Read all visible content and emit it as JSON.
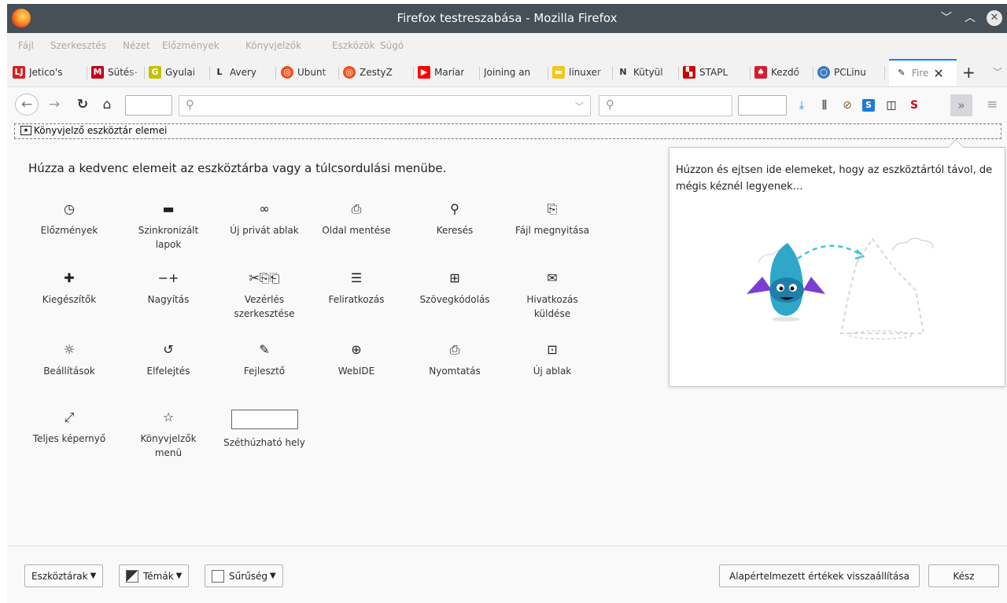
{
  "window": {
    "title": "Firefox testreszabása - Mozilla Firefox"
  },
  "menubar": [
    "Fájl",
    "Szerkesztés",
    "Nézet",
    "Előzmények",
    "Könyvjelzők",
    "Eszközök",
    "Súgó"
  ],
  "tabs": [
    {
      "label": "Jetico's",
      "favicon_color": "#d32020",
      "glyph": "LJ"
    },
    {
      "label": "Sütés-",
      "favicon_color": "#c3001a",
      "glyph": "M"
    },
    {
      "label": "Gyulai",
      "favicon_color": "#c6c000",
      "glyph": "G"
    },
    {
      "label": "Avery",
      "favicon_color": "#222222",
      "glyph": "L"
    },
    {
      "label": "Ubunt",
      "favicon_color": "#e95420",
      "glyph": "◎"
    },
    {
      "label": "ZestyZ",
      "favicon_color": "#e95420",
      "glyph": "◎"
    },
    {
      "label": "Mariar",
      "favicon_color": "#ff0000",
      "glyph": "▶"
    },
    {
      "label": "Joining an",
      "favicon_color": "",
      "glyph": ""
    },
    {
      "label": "linuxer",
      "favicon_color": "#f5c518",
      "glyph": "▬"
    },
    {
      "label": "Kütyül",
      "favicon_color": "#333333",
      "glyph": "N"
    },
    {
      "label": "STAPL",
      "favicon_color": "#cc0000",
      "glyph": "▚"
    },
    {
      "label": "Kezdő",
      "favicon_color": "#d21f2e",
      "glyph": "♠"
    },
    {
      "label": "PCLinu",
      "favicon_color": "#3b7bbf",
      "glyph": "○"
    }
  ],
  "active_tab": {
    "label": "Fire",
    "close": "✕"
  },
  "toolbar": {
    "urlbar_icon": "search-icon",
    "overflow_label": "»"
  },
  "bookmarks_toolbar": {
    "label": "Könyvjelző eszköztár elemei"
  },
  "customize": {
    "heading": "Húzza a kedvenc elemeit az eszköztárba vagy a túlcsordulási menübe.",
    "items": [
      {
        "icon": "◷",
        "label": "Előzmények"
      },
      {
        "icon": "▬",
        "label": "Szinkronizált lapok"
      },
      {
        "icon": "∞",
        "label": "Új privát ablak"
      },
      {
        "icon": "⎙",
        "label": "Oldal mentése"
      },
      {
        "icon": "⚲",
        "label": "Keresés"
      },
      {
        "icon": "⎘",
        "label": "Fájl megnyitása"
      },
      {
        "icon": "✚",
        "label": "Kiegészítők"
      },
      {
        "icon": "−+",
        "label": "Nagyítás"
      },
      {
        "icon": "✂⎘⎗",
        "label": "Vezérlés szerkesztése"
      },
      {
        "icon": "☰",
        "label": "Feliratkozás"
      },
      {
        "icon": "⊞",
        "label": "Szövegkódolás"
      },
      {
        "icon": "✉",
        "label": "Hivatkozás küldése"
      },
      {
        "icon": "☼",
        "label": "Beállítások"
      },
      {
        "icon": "↺",
        "label": "Elfelejtés"
      },
      {
        "icon": "✎",
        "label": "Fejlesztő"
      },
      {
        "icon": "⊕",
        "label": "WebIDE"
      },
      {
        "icon": "⎙",
        "label": "Nyomtatás"
      },
      {
        "icon": "⊡",
        "label": "Új ablak"
      },
      {
        "icon": "⤢",
        "label": "Teljes képernyő"
      },
      {
        "icon": "☆",
        "label": "Könyvjelzők menü"
      },
      {
        "icon": "",
        "label": "Széthúzható hely"
      }
    ]
  },
  "overflow_panel": {
    "text": "Húzzon és ejtsen ide elemeket, hogy az eszköztártól távol, de mégis kéznél legyenek…"
  },
  "footer": {
    "toolbars": "Eszköztárak",
    "themes": "Témák",
    "density": "Sűrűség",
    "restore_defaults": "Alapértelmezett értékek visszaállítása",
    "done": "Kész"
  },
  "colors": {
    "accent": "#0a84ff",
    "titlebar": "#475057"
  }
}
